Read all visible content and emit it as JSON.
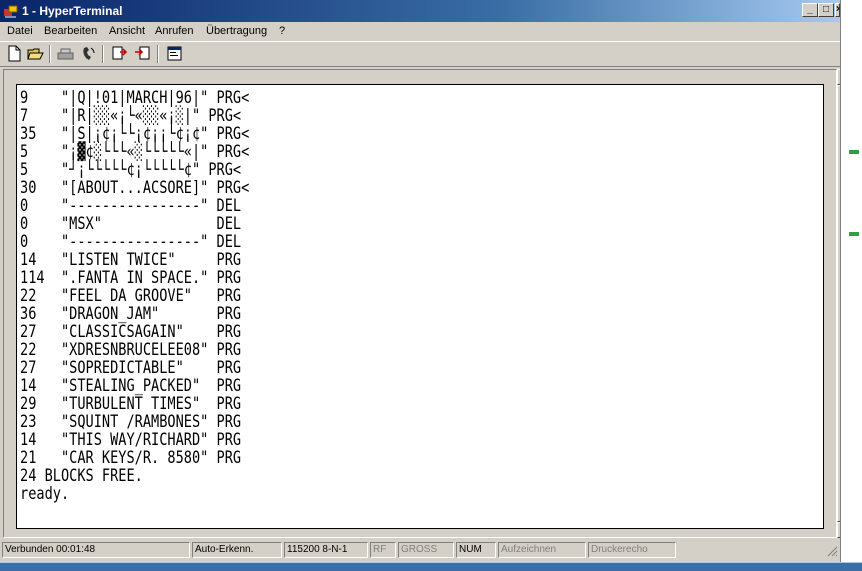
{
  "window": {
    "title": "1 - HyperTerminal",
    "minimize_label": "_",
    "maximize_label": "□",
    "close_label": "×"
  },
  "menu": {
    "items": [
      "Datei",
      "Bearbeiten",
      "Ansicht",
      "Anrufen",
      "Übertragung",
      "?"
    ]
  },
  "toolbar": {
    "buttons": [
      "new-icon",
      "open-icon",
      "disconnect-icon",
      "call-icon",
      "send-icon",
      "receive-icon",
      "properties-icon"
    ]
  },
  "terminal": {
    "lines": [
      "9    \"|Q|!01|MARCH|96|\" PRG<",
      "7    \"|R|░░«¡└«░░«¡░|\" PRG<",
      "35   \"|S|¡¢¡└└¡¢¡¡└¢¡¢\" PRG<",
      "5    \"¡▓¢░└└└«░└└└└└«|\" PRG<",
      "5    \"┘¡└└└└└¢¡└└└└└¢\" PRG<",
      "30   \"[ABOUT...ACSORE]\" PRG<",
      "0    \"----------------\" DEL",
      "0    \"MSX\"              DEL",
      "0    \"----------------\" DEL",
      "14   \"LISTEN TWICE\"     PRG",
      "114  \".FANTA IN SPACE.\" PRG",
      "22   \"FEEL DA GROOVE\"   PRG",
      "36   \"DRAGON_JAM\"       PRG",
      "27   \"CLASSICSAGAIN\"    PRG",
      "22   \"XDRESNBRUCELEE08\" PRG",
      "27   \"SOPREDICTABLE\"    PRG",
      "14   \"STEALING_PACKED\"  PRG",
      "29   \"TURBULENT TIMES\"  PRG",
      "23   \"SQUINT /RAMBONES\" PRG",
      "14   \"THIS WAY/RICHARD\" PRG",
      "21   \"CAR KEYS/R. 8580\" PRG",
      "24 BLOCKS FREE.",
      "ready."
    ]
  },
  "status": {
    "connected": "Verbunden 00:01:48",
    "detect": "Auto-Erkenn.",
    "params": "115200 8-N-1",
    "rf": "RF",
    "caps": "GROSS",
    "num": "NUM",
    "capture": "Aufzeichnen",
    "echo": "Druckerecho"
  },
  "colors": {
    "title_start": "#0a246a",
    "title_end": "#a6caf0",
    "face": "#d4d0c8"
  }
}
